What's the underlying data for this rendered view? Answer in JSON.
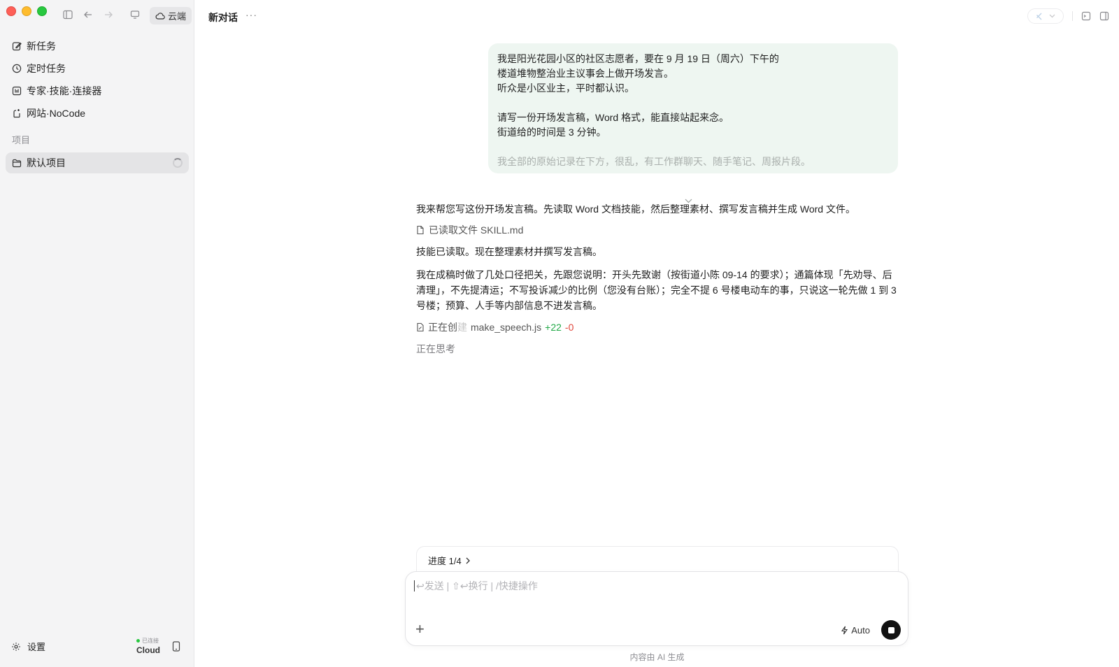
{
  "sidebar": {
    "cloud_label": "云端",
    "items": [
      {
        "label": "新任务"
      },
      {
        "label": "定时任务"
      },
      {
        "label": "专家·技能·连接器"
      },
      {
        "label": "网站·NoCode"
      }
    ],
    "section_title": "项目",
    "project": {
      "label": "默认项目"
    },
    "settings_label": "设置",
    "connection_status": "已连接",
    "connection_name": "Cloud"
  },
  "header": {
    "title": "新对话",
    "more": "···"
  },
  "conversation": {
    "user_message": {
      "lines": [
        "我是阳光花园小区的社区志愿者，要在 9 月 19 日（周六）下午的",
        "楼道堆物整治业主议事会上做开场发言。",
        "听众是小区业主，平时都认识。",
        "请写一份开场发言稿，Word 格式，能直接站起来念。",
        "街道给的时间是 3 分钟。",
        "我全部的原始记录在下方，很乱，有工作群聊天、随手笔记、周报片段。"
      ]
    },
    "assistant": {
      "p1": "我来帮您写这份开场发言稿。先读取 Word 文档技能，然后整理素材、撰写发言稿并生成 Word 文件。",
      "file_read": "已读取文件 SKILL.md",
      "p2": "技能已读取。现在整理素材并撰写发言稿。",
      "p3": "我在成稿时做了几处口径把关，先跟您说明：开头先致谢（按街道小陈 09-14 的要求）；通篇体现「先劝导、后清理」，不先提清运；不写投诉减少的比例（您没有台账）；完全不提 6 号楼电动车的事，只说这一轮先做 1 到 3 号楼；预算、人手等内部信息不进发言稿。",
      "edit_prefix": "正在创",
      "edit_prefix_fade": "建",
      "edit_file": "make_speech.js",
      "edit_added": "+22",
      "edit_removed": "-0",
      "thinking": "正在思考"
    }
  },
  "progress": {
    "label": "进度 1/4"
  },
  "composer": {
    "placeholder": "↩发送 | ⇧↩换行 | /快捷操作",
    "mode_label": "Auto"
  },
  "disclaimer": "内容由 AI 生成",
  "colors": {
    "user_bubble_bg": "#eef6f1",
    "added": "#22a947",
    "removed": "#e0453a",
    "status_dot": "#28c840"
  }
}
